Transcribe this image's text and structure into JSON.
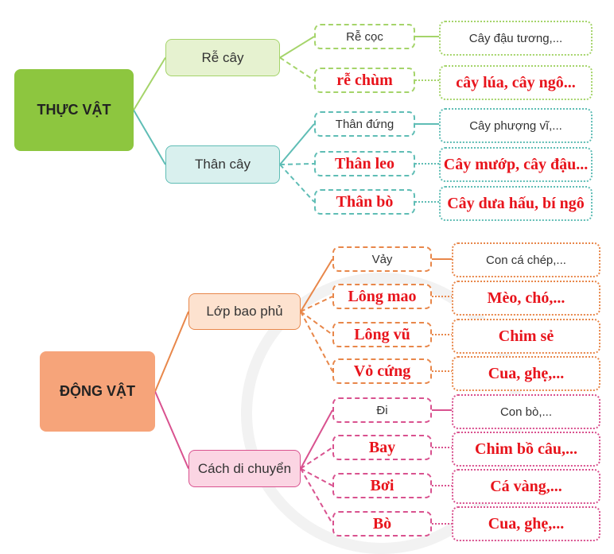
{
  "colors": {
    "plant": "#8dc63f",
    "plant_root": "#a5d46a",
    "plant_stem": "#5fbdb5",
    "animal": "#f6a47a",
    "animal_cover": "#e8874a",
    "animal_move": "#d9528f",
    "answer": "#e8141c"
  },
  "plants": {
    "title": "THỰC VẬT",
    "groups": [
      {
        "label": "Rễ cây",
        "items": [
          {
            "type": "Rễ cọc",
            "example": "Cây đậu tương,...",
            "answer": false
          },
          {
            "type": "rễ chùm",
            "example": "cây lúa, cây ngô...",
            "answer": true
          }
        ]
      },
      {
        "label": "Thân cây",
        "items": [
          {
            "type": "Thân đứng",
            "example": "Cây phượng vĩ,...",
            "answer": false
          },
          {
            "type": "Thân leo",
            "example": "Cây mướp, cây đậu...",
            "answer": true
          },
          {
            "type": "Thân bò",
            "example": "Cây dưa hấu, bí ngô",
            "answer": true
          }
        ]
      }
    ]
  },
  "animals": {
    "title": "ĐỘNG VẬT",
    "groups": [
      {
        "label": "Lớp bao phủ",
        "items": [
          {
            "type": "Vảy",
            "example": "Con cá chép,...",
            "answer": false
          },
          {
            "type": "Lông mao",
            "example": "Mèo, chó,...",
            "answer": true
          },
          {
            "type": "Lông vũ",
            "example": "Chim sẻ",
            "answer": true
          },
          {
            "type": "Vỏ cứng",
            "example": "Cua, ghẹ,...",
            "answer": true
          }
        ]
      },
      {
        "label": "Cách di chuyển",
        "items": [
          {
            "type": "Đi",
            "example": "Con bò,...",
            "answer": false
          },
          {
            "type": "Bay",
            "example": "Chim bồ câu,...",
            "answer": true
          },
          {
            "type": "Bơi",
            "example": "Cá vàng,...",
            "answer": true
          },
          {
            "type": "Bò",
            "example": "Cua, ghẹ,...",
            "answer": true
          }
        ]
      }
    ]
  }
}
